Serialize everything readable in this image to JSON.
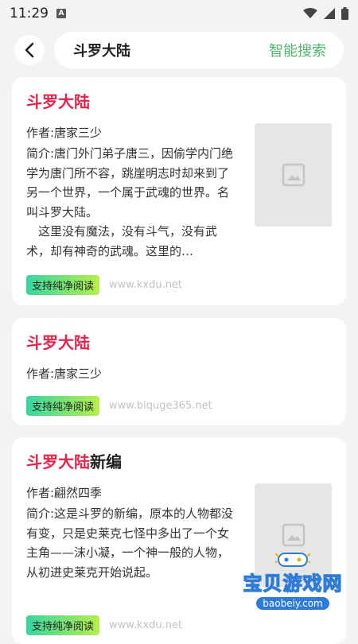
{
  "status": {
    "time": "11:29",
    "notification_icon": "A"
  },
  "header": {
    "query": "斗罗大陆",
    "action": "智能搜索"
  },
  "results": [
    {
      "title_highlight": "斗罗大陆",
      "title_rest": "",
      "author": "作者:唐家三少",
      "intro": "简介:唐门外门弟子唐三，因偷学内门绝学为唐门所不容，跳崖明志时却来到了另一个世界，一个属于武魂的世界。名叫斗罗大陆。\n　这里没有魔法，没有斗气，没有武术，却有神奇的武魂。这里的…",
      "badge": "支持纯净阅读",
      "domain": "www.kxdu.net"
    },
    {
      "title_highlight": "斗罗大陆",
      "title_rest": "",
      "author": "作者:唐家三少",
      "badge": "支持纯净阅读",
      "domain": "www.biquge365.net"
    },
    {
      "title_highlight": "斗罗大陆",
      "title_rest": "新编",
      "author": "作者:翩然四季",
      "intro": "简介:这是斗罗的新编，原本的人物都没有变，只是史莱克七怪中多出了一个女主角——沫小凝，一个神一般的人物，从初进史莱克开始说起。",
      "badge": "支持纯净阅读",
      "domain": "www.kxdu.net"
    }
  ],
  "watermark": {
    "name": "宝贝游戏网",
    "url": "baobeiy.com"
  }
}
